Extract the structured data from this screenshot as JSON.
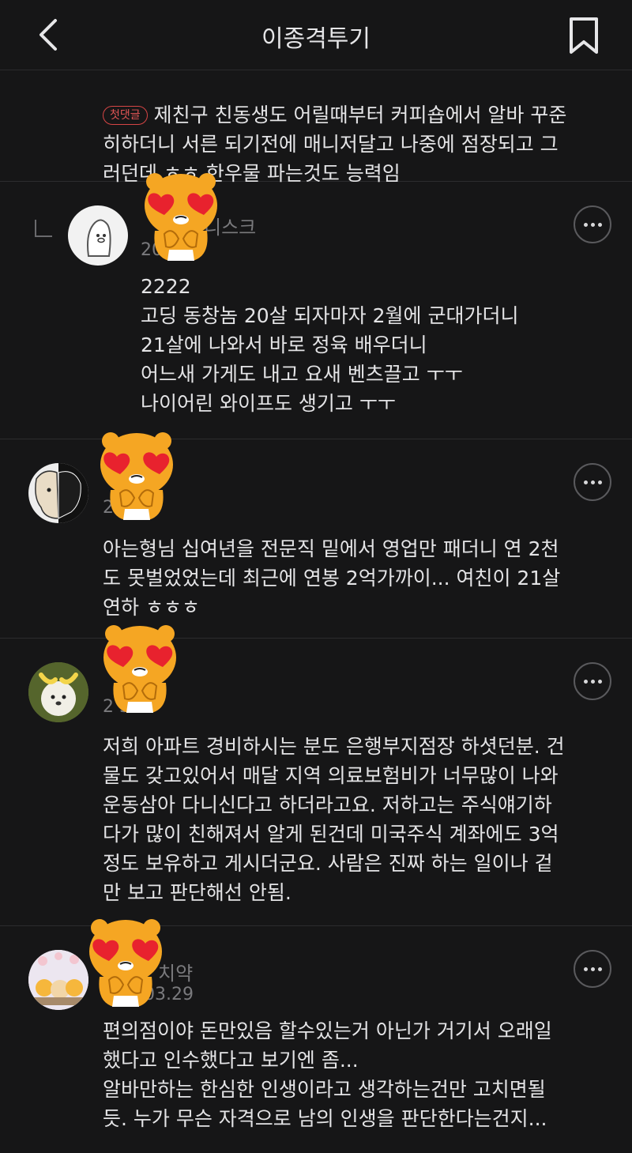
{
  "header": {
    "title": "이종격투기"
  },
  "comment0": {
    "badge": "첫댓글",
    "text": "제친구 친동생도 어릴때부터 커피숍에서 알바 꾸준\n히하더니 서른 되기전에 매니저달고 나중에 점장되고 그\n러던데 ㅎㅎ 한우물 파는것도 능력임"
  },
  "comment1": {
    "nick": "니스크",
    "date": "20  .29",
    "text": "2222\n고딩 동창놈 20살 되자마자 2월에 군대가더니\n21살에 나와서 바로 정육 배우더니\n어느새 가게도 내고 요새 벤츠끌고 ㅜㅜ\n나이어린 와이프도 생기고 ㅜㅜ"
  },
  "comment2": {
    "date": "2  3.29",
    "text": "아는형님 십여년을 전문직 밑에서 영업만 패더니 연 2천\n도 못벌었었는데 최근에 연봉 2억가까이... 여친이 21살\n연하 ㅎㅎㅎ"
  },
  "comment3": {
    "date": "2  3.29",
    "text": "저희 아파트 경비하시는 분도 은행부지점장 하셧던분. 건\n물도 갖고있어서 매달 지역 의료보험비가 너무많이 나와\n운동삼아 다니신다고 하더라고요. 저하고는 주식얘기하\n다가 많이 친해져서 알게 된건데 미국주식 계좌에도 3억\n정도 보유하고 게시더군요. 사람은 진짜 하는 일이나 겉\n만 보고 판단해선 안됨."
  },
  "comment4": {
    "nick": "치약",
    "date": "03.29",
    "text": "편의점이야 돈만있음 할수있는거 아닌가 거기서 오래일\n했다고 인수했다고 보기엔 좀...\n알바만하는 한심한 인생이라고 생각하는건만 고치면될\n듯. 누가 무슨 자격으로 남의 인생을 판단한다는건지..."
  },
  "icons": {
    "back": "chevron-left-icon",
    "bookmark": "bookmark-icon",
    "more": "more-horizontal-icon",
    "sticker": "heart-eyes-lion-sticker"
  },
  "colors": {
    "background": "#161617",
    "text": "#e4e4e6",
    "muted": "#7a7a7d",
    "badge": "#e05555",
    "sticker": "#f5a623",
    "heart": "#e8222e"
  }
}
